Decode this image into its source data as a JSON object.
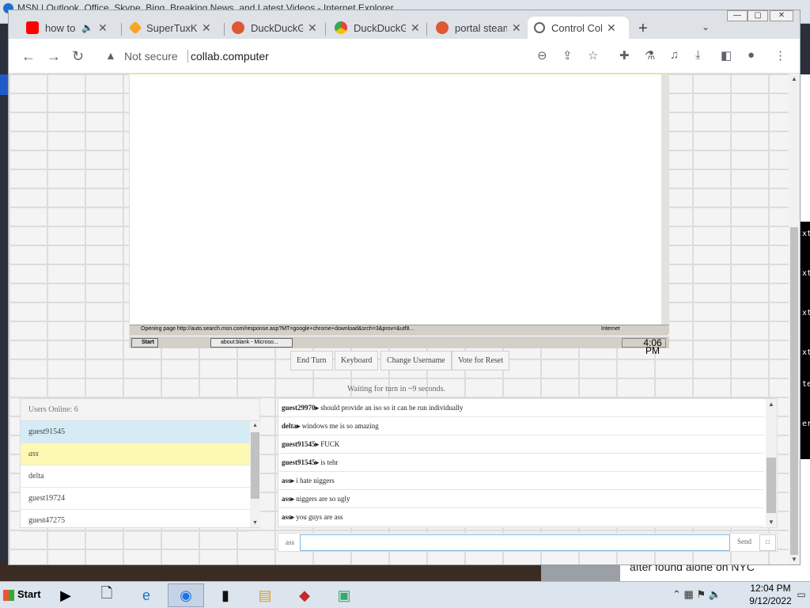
{
  "background_window": {
    "title": "MSN | Outlook, Office, Skype, Bing, Breaking News, and Latest Videos - Internet Explorer"
  },
  "browser": {
    "tabs": [
      {
        "label": "how to",
        "icon": "youtube-icon",
        "color": "#ff0000",
        "audio": true
      },
      {
        "label": "SuperTuxKar",
        "icon": "supertuxkart-icon",
        "color": "#f5a623"
      },
      {
        "label": "DuckDuckG",
        "icon": "duckduckgo-icon",
        "color": "#de5833"
      },
      {
        "label": "DuckDuckG",
        "icon": "chrome-icon",
        "color": "#de5833"
      },
      {
        "label": "portal steam",
        "icon": "duckduckgo-icon",
        "color": "#de5833"
      },
      {
        "label": "Control Coll",
        "icon": "globe-icon",
        "color": "#5f6368",
        "active": true
      }
    ],
    "new_tab": "+",
    "address": {
      "security": "Not secure",
      "url": "collab.computer"
    }
  },
  "vm": {
    "status_text": "Opening page http://auto.search.msn.com/response.asp?MT=google+chrome+download&srch=3&prov=&utf8...",
    "zone": "Internet",
    "start": "Start",
    "task_button": "about:blank - Microso...",
    "clock": "4:06 PM"
  },
  "controls": {
    "end_turn": "End Turn",
    "keyboard": "Keyboard",
    "change_username": "Change Username",
    "vote_reset": "Vote for Reset",
    "waiting": "Waiting for turn in ~9 seconds."
  },
  "users": {
    "header": "Users Online: 6",
    "list": [
      {
        "name": "guest91545"
      },
      {
        "name": "ass"
      },
      {
        "name": "delta"
      },
      {
        "name": "guest19724"
      },
      {
        "name": "guest47275"
      }
    ]
  },
  "chat": {
    "messages": [
      {
        "user": "guest29970",
        "text": "should provide an iso so it can be run individually"
      },
      {
        "user": "delta",
        "text": "windows me is so amazing"
      },
      {
        "user": "guest91545",
        "text": "FUCK"
      },
      {
        "user": "guest91545",
        "text": "is tehr"
      },
      {
        "user": "ass",
        "text": "i hate niggers"
      },
      {
        "user": "ass",
        "text": "niggers are so ugly"
      },
      {
        "user": "ass",
        "text": "you guys are ass"
      }
    ],
    "username": "ass",
    "send": "Send"
  },
  "news_snippet": "after found alone on NYC",
  "taskbar": {
    "start": "Start",
    "time": "12:04 PM",
    "date": "9/12/2022"
  }
}
